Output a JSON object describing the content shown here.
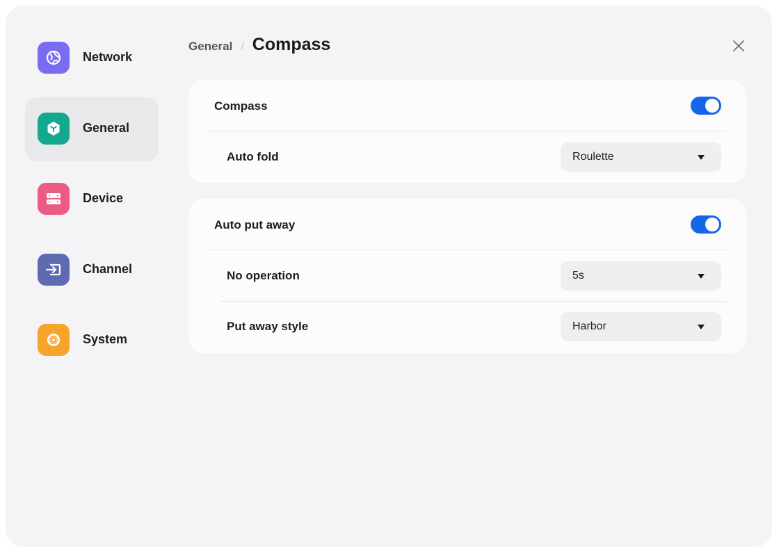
{
  "sidebar": {
    "items": [
      {
        "label": "Network",
        "icon": "globe-icon",
        "color": "#7a6cf0"
      },
      {
        "label": "General",
        "icon": "cube-icon",
        "color": "#14a98f"
      },
      {
        "label": "Device",
        "icon": "server-icon",
        "color": "#ec5b83"
      },
      {
        "label": "Channel",
        "icon": "input-arrow-icon",
        "color": "#5f6ab0"
      },
      {
        "label": "System",
        "icon": "atom-icon",
        "color": "#f7a42c"
      }
    ],
    "active": "General"
  },
  "header": {
    "breadcrumb": "General",
    "separator": "/",
    "title": "Compass"
  },
  "compass_card": {
    "toggle_label": "Compass",
    "toggle_on": true,
    "auto_fold_label": "Auto fold",
    "auto_fold_value": "Roulette"
  },
  "put_away_card": {
    "toggle_label": "Auto put away",
    "toggle_on": true,
    "no_operation_label": "No operation",
    "no_operation_value": "5s",
    "style_label": "Put away style",
    "style_value": "Harbor"
  },
  "colors": {
    "accent": "#1467e6",
    "background": "#f4f4f6",
    "card": "#fcfcfd"
  }
}
